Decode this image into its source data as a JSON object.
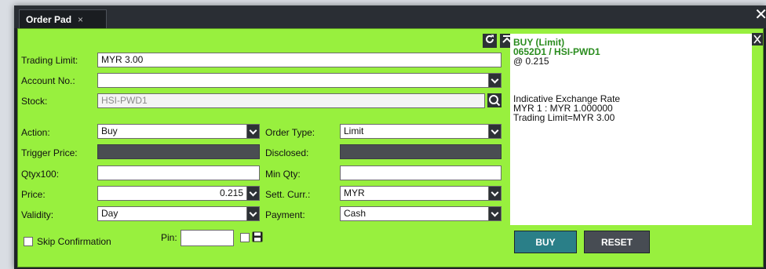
{
  "window": {
    "tab_title": "Order Pad",
    "tab_close": "×",
    "close_glyph": "✕"
  },
  "form": {
    "trading_limit": {
      "label": "Trading Limit:",
      "value": "MYR 3.00"
    },
    "account_no": {
      "label": "Account No.:",
      "value": ""
    },
    "stock": {
      "label": "Stock:",
      "value": "HSI-PWD1"
    },
    "action": {
      "label": "Action:",
      "value": "Buy"
    },
    "order_type": {
      "label": "Order Type:",
      "value": "Limit"
    },
    "trigger_price": {
      "label": "Trigger Price:",
      "value": ""
    },
    "disclosed": {
      "label": "Disclosed:",
      "value": ""
    },
    "qty": {
      "label": "Qtyx100:",
      "value": ""
    },
    "min_qty": {
      "label": "Min Qty:",
      "value": ""
    },
    "price": {
      "label": "Price:",
      "value": "0.215"
    },
    "sett_curr": {
      "label": "Sett. Curr.:",
      "value": "MYR"
    },
    "validity": {
      "label": "Validity:",
      "value": "Day"
    },
    "payment": {
      "label": "Payment:",
      "value": "Cash"
    },
    "skip_confirmation": {
      "label": "Skip Confirmation",
      "checked": false
    },
    "pin": {
      "label": "Pin:",
      "value": ""
    }
  },
  "info": {
    "side": "BUY (Limit)",
    "instrument": "0652D1 / HSI-PWD1",
    "price": "@ 0.215",
    "fx_title": "Indicative Exchange Rate",
    "fx_rate": "MYR 1 : MYR 1.000000",
    "trading_limit": "Trading Limit=MYR 3.00"
  },
  "buttons": {
    "buy": "BUY",
    "reset": "RESET"
  },
  "colors": {
    "panel_bg": "#98f03e",
    "buy_button": "#2a7f88",
    "reset_button": "#474c53",
    "info_highlight": "#2a8c1e"
  },
  "icons": [
    "refresh-icon",
    "collapse-icon",
    "search-icon",
    "save-icon",
    "expand-icon",
    "close-icon",
    "dropdown-chevron-icon"
  ]
}
